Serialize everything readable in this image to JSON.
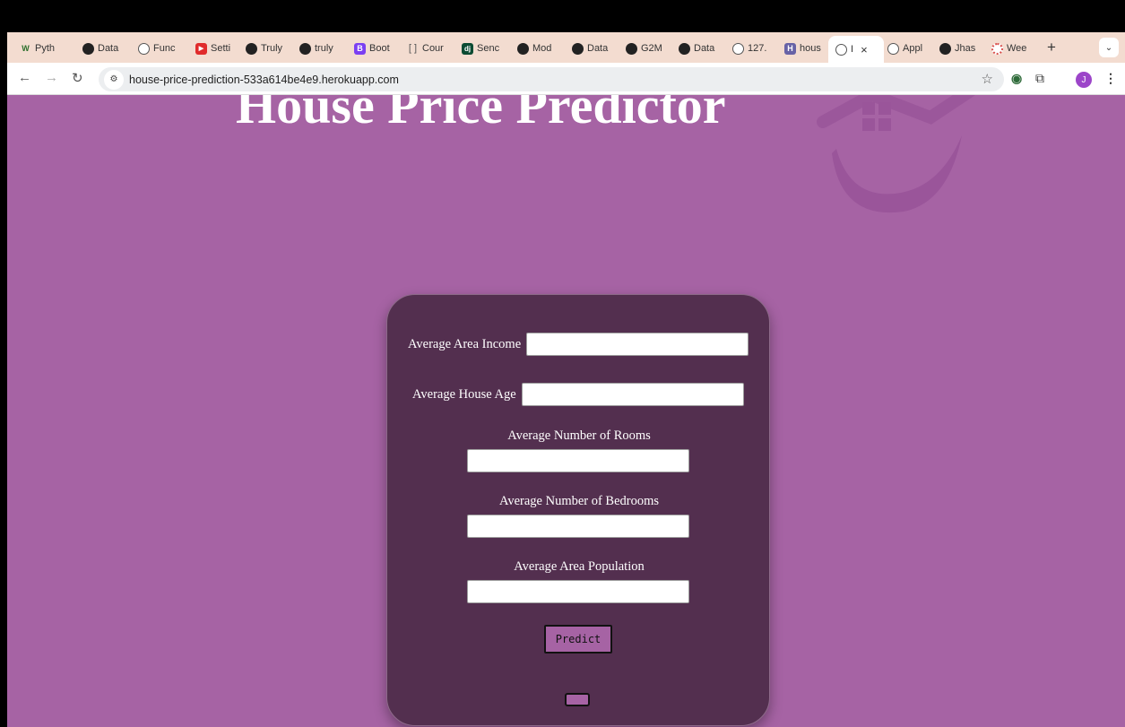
{
  "browser": {
    "tabs": [
      {
        "label": "Pyth",
        "icon": "w-icon",
        "color": "#2a6e2a"
      },
      {
        "label": "Data",
        "icon": "github-icon",
        "color": "#222222"
      },
      {
        "label": "Func",
        "icon": "globe-icon",
        "color": "#555555"
      },
      {
        "label": "Setti",
        "icon": "youtube-icon",
        "color": "#e02b2b"
      },
      {
        "label": "Truly",
        "icon": "github-icon",
        "color": "#222222"
      },
      {
        "label": "truly",
        "icon": "github-icon",
        "color": "#222222"
      },
      {
        "label": "Boot",
        "icon": "bootstrap-icon",
        "color": "#7b3ff2"
      },
      {
        "label": "Cour",
        "icon": "bracket-icon",
        "color": "#555555"
      },
      {
        "label": "Senc",
        "icon": "django-icon",
        "color": "#0c4b33"
      },
      {
        "label": "Mod",
        "icon": "github-icon",
        "color": "#222222"
      },
      {
        "label": "Data",
        "icon": "github-icon",
        "color": "#222222"
      },
      {
        "label": "G2M",
        "icon": "github-icon",
        "color": "#222222"
      },
      {
        "label": "Data",
        "icon": "github-icon",
        "color": "#222222"
      },
      {
        "label": "127.",
        "icon": "globe-icon",
        "color": "#555555"
      },
      {
        "label": "hous",
        "icon": "heroku-icon",
        "color": "#6762a6"
      }
    ],
    "active_tab": {
      "label": "I",
      "close": "×"
    },
    "tabs_after": [
      {
        "label": "Appl",
        "icon": "globe-icon",
        "color": "#555555"
      },
      {
        "label": "Jhas",
        "icon": "github-icon",
        "color": "#222222"
      },
      {
        "label": "Wee",
        "icon": "spinner-icon",
        "color": "#d9534f"
      }
    ],
    "new_tab": "+",
    "url": "house-price-prediction-533a614be4e9.herokuapp.com",
    "avatar_letter": "J"
  },
  "page": {
    "title": "House Price Predictor",
    "accent": "#a663a4",
    "card_color": "#532f4f",
    "fields": [
      {
        "label": "Average Area Income",
        "value": ""
      },
      {
        "label": "Average House Age",
        "value": ""
      },
      {
        "label": "Average Number of Rooms",
        "value": ""
      },
      {
        "label": "Average Number of Bedrooms",
        "value": ""
      },
      {
        "label": "Average Area Population",
        "value": ""
      }
    ],
    "predict_label": "Predict"
  }
}
